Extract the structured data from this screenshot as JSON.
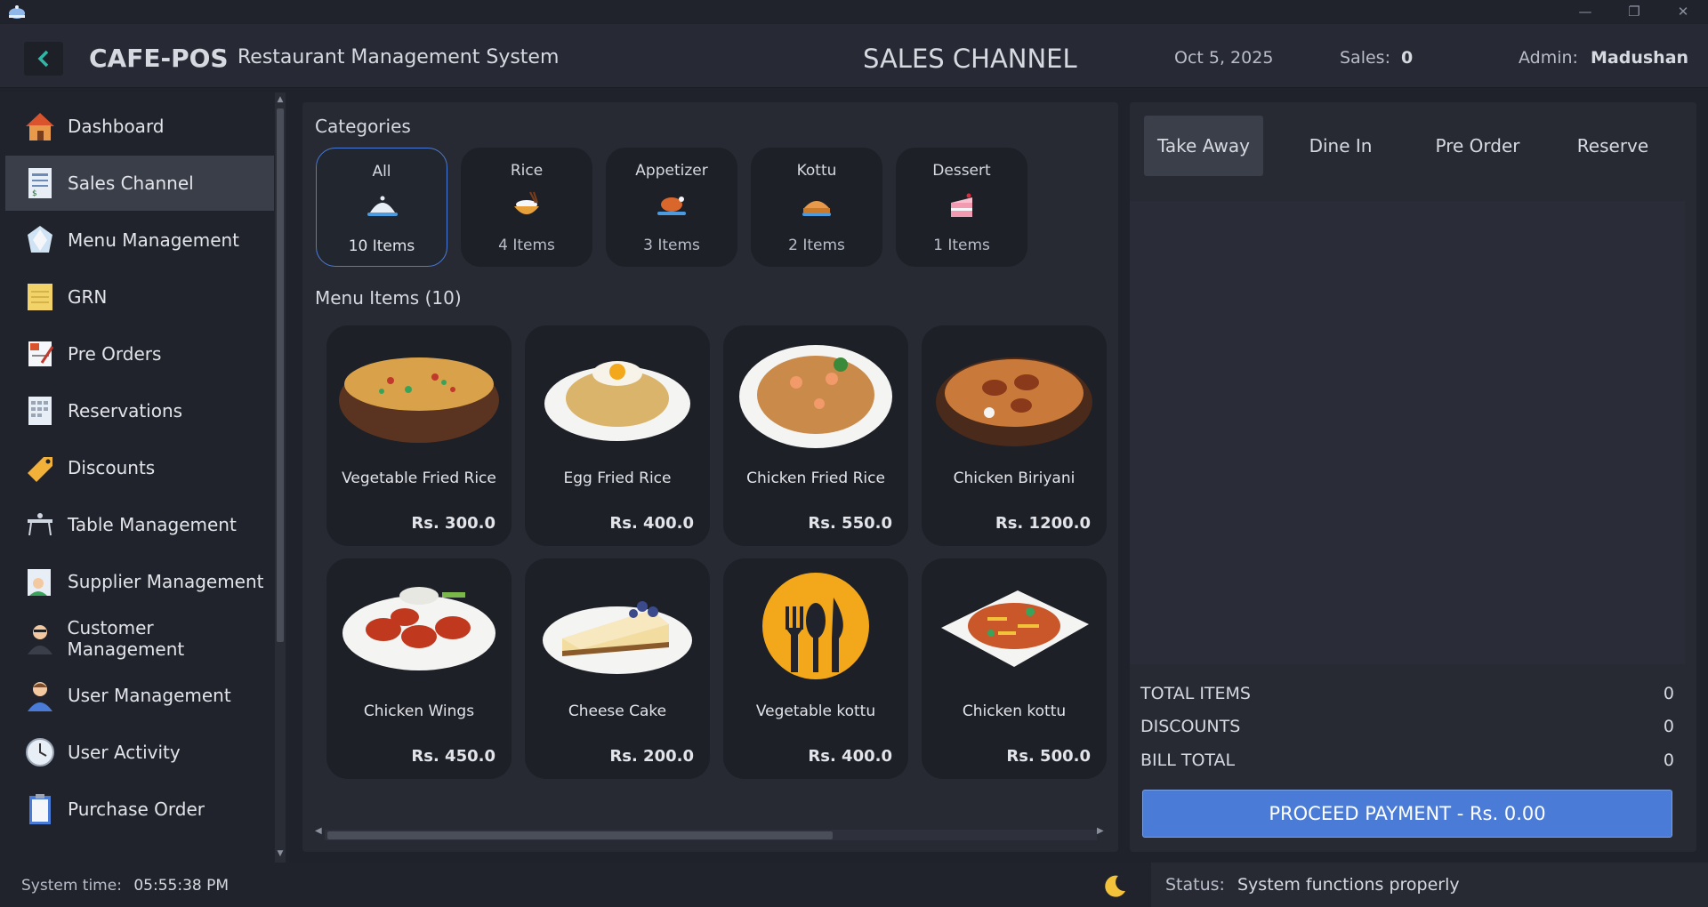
{
  "header": {
    "brand": "CAFE-POS",
    "subtitle": "Restaurant Management System",
    "page_title": "SALES CHANNEL",
    "date": "Oct 5, 2025",
    "sales_label": "Sales:",
    "sales_value": "0",
    "admin_label": "Admin:",
    "admin_value": "Madushan"
  },
  "sidebar": {
    "items": [
      {
        "label": "Dashboard",
        "icon": "house-icon"
      },
      {
        "label": "Sales Channel",
        "icon": "invoice-icon"
      },
      {
        "label": "Menu Management",
        "icon": "menu-icon"
      },
      {
        "label": "GRN",
        "icon": "notepad-icon"
      },
      {
        "label": "Pre Orders",
        "icon": "clipboard-icon"
      },
      {
        "label": "Reservations",
        "icon": "calendar-icon"
      },
      {
        "label": "Discounts",
        "icon": "tag-icon"
      },
      {
        "label": "Table Management",
        "icon": "table-icon"
      },
      {
        "label": "Supplier Management",
        "icon": "supplier-icon"
      },
      {
        "label": "Customer Management",
        "icon": "customer-icon"
      },
      {
        "label": "User Management",
        "icon": "user-icon"
      },
      {
        "label": "User Activity",
        "icon": "clock-icon"
      },
      {
        "label": "Purchase Order",
        "icon": "clipboard-list-icon"
      }
    ],
    "active_index": 1
  },
  "categories": {
    "title": "Categories",
    "items": [
      {
        "name": "All",
        "count": "10 Items"
      },
      {
        "name": "Rice",
        "count": "4 Items"
      },
      {
        "name": "Appetizer",
        "count": "3 Items"
      },
      {
        "name": "Kottu",
        "count": "2 Items"
      },
      {
        "name": "Dessert",
        "count": "1 Items"
      }
    ]
  },
  "menu": {
    "title": "Menu Items (10)",
    "items": [
      {
        "name": "Vegetable Fried Rice",
        "price": "Rs. 300.0"
      },
      {
        "name": "Egg Fried Rice",
        "price": "Rs. 400.0"
      },
      {
        "name": "Chicken Fried Rice",
        "price": "Rs. 550.0"
      },
      {
        "name": "Chicken Biriyani",
        "price": "Rs. 1200.0"
      },
      {
        "name": "Chicken Wings",
        "price": "Rs. 450.0"
      },
      {
        "name": "Cheese Cake",
        "price": "Rs. 200.0"
      },
      {
        "name": "Vegetable kottu",
        "price": "Rs. 400.0"
      },
      {
        "name": "Chicken kottu",
        "price": "Rs. 500.0"
      }
    ]
  },
  "order": {
    "tabs": [
      "Take Away",
      "Dine In",
      "Pre Order",
      "Reserve"
    ],
    "active_tab": 0,
    "total_items_label": "TOTAL ITEMS",
    "total_items_value": "0",
    "discounts_label": "DISCOUNTS",
    "discounts_value": "0",
    "bill_total_label": "BILL TOTAL",
    "bill_total_value": "0",
    "pay_label": "PROCEED PAYMENT - Rs. 0.00"
  },
  "statusbar": {
    "time_label": "System time:",
    "time_value": "05:55:38 PM",
    "status_label": "Status:",
    "status_value": "System functions properly"
  },
  "colors": {
    "accent": "#4a7bd6",
    "background": "#1f222b",
    "panel": "#272a33"
  }
}
